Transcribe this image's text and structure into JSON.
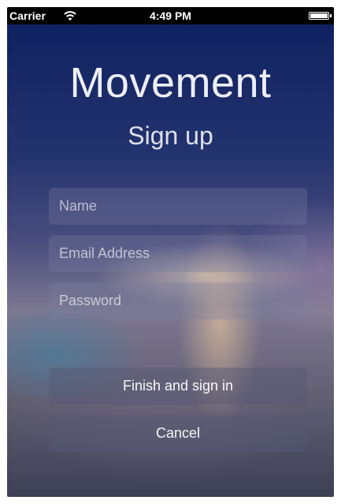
{
  "status_bar": {
    "carrier": "Carrier",
    "time": "4:49 PM",
    "wifi_icon": "wifi-icon",
    "battery_icon": "battery-icon",
    "battery_level": 1.0
  },
  "header": {
    "app_title": "Movement",
    "subtitle": "Sign up"
  },
  "form": {
    "name": {
      "value": "",
      "placeholder": "Name"
    },
    "email": {
      "value": "",
      "placeholder": "Email Address"
    },
    "password": {
      "value": "",
      "placeholder": "Password"
    }
  },
  "actions": {
    "finish_label": "Finish and sign in",
    "cancel_label": "Cancel"
  },
  "colors": {
    "status_bar_bg": "#000000",
    "text": "#ffffff",
    "background_top": "#0e1f60",
    "background_bottom": "#3d3f55"
  }
}
